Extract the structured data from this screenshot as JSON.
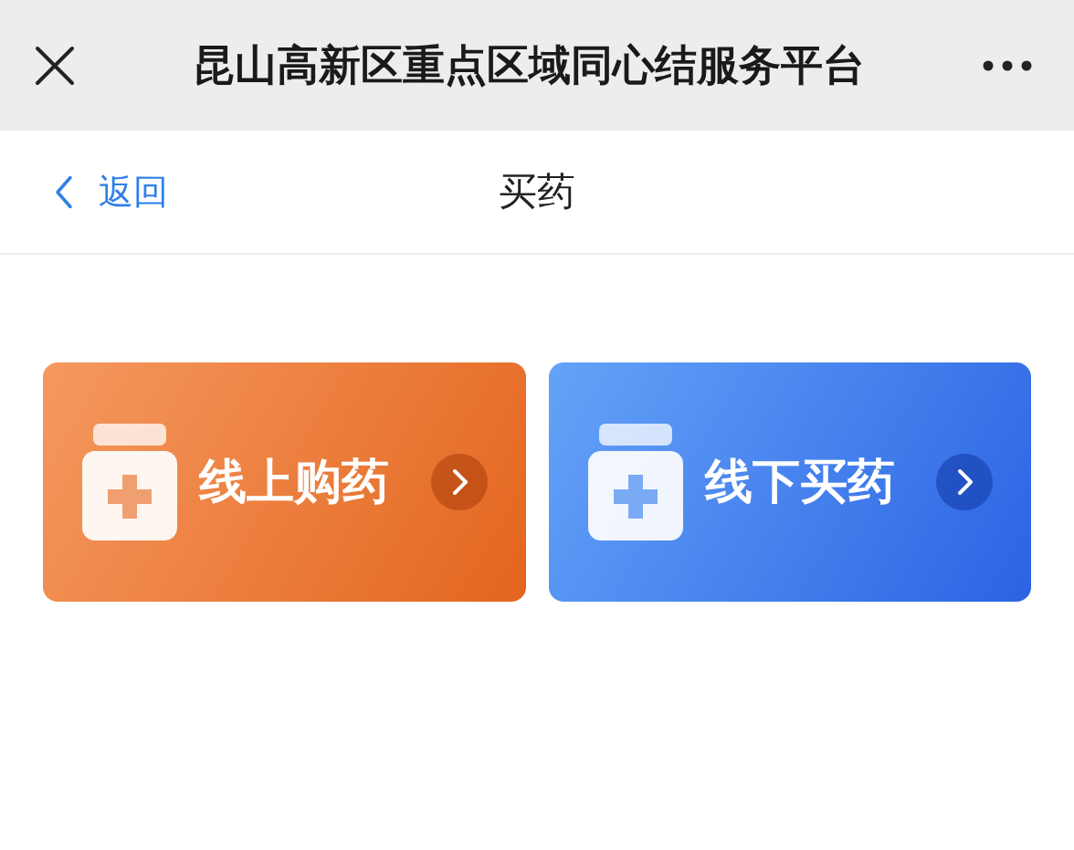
{
  "window": {
    "title": "昆山高新区重点区域同心结服务平台"
  },
  "nav": {
    "back": "返回",
    "title": "买药"
  },
  "cards": [
    {
      "label": "线上购药",
      "kind": "orange"
    },
    {
      "label": "线下买药",
      "kind": "blue"
    }
  ]
}
